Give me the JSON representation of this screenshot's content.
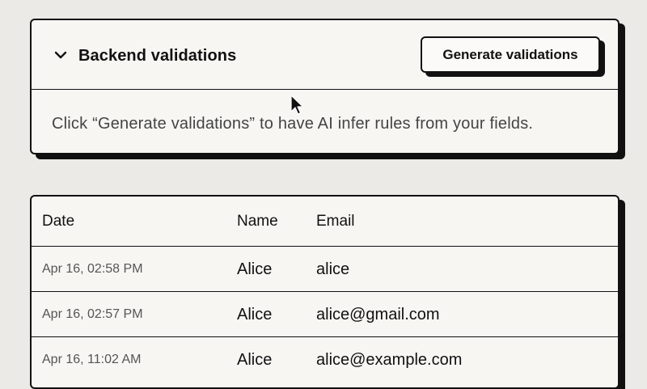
{
  "validations": {
    "title": "Backend validations",
    "generate_button_label": "Generate validations",
    "hint": "Click “Generate validations” to have AI infer rules from your fields.",
    "collapse_icon": "chevron-down-icon"
  },
  "submissions": {
    "columns": [
      "Date",
      "Name",
      "Email"
    ],
    "rows": [
      {
        "date": "Apr 16, 02:58 PM",
        "name": "Alice",
        "email": "alice"
      },
      {
        "date": "Apr 16, 02:57 PM",
        "name": "Alice",
        "email": "alice@gmail.com"
      },
      {
        "date": "Apr 16, 11:02 AM",
        "name": "Alice",
        "email": "alice@example.com"
      }
    ]
  },
  "colors": {
    "page_background": "#ebeae6",
    "panel_background": "#f7f6f3",
    "border": "#111111",
    "muted_text": "#555555"
  }
}
